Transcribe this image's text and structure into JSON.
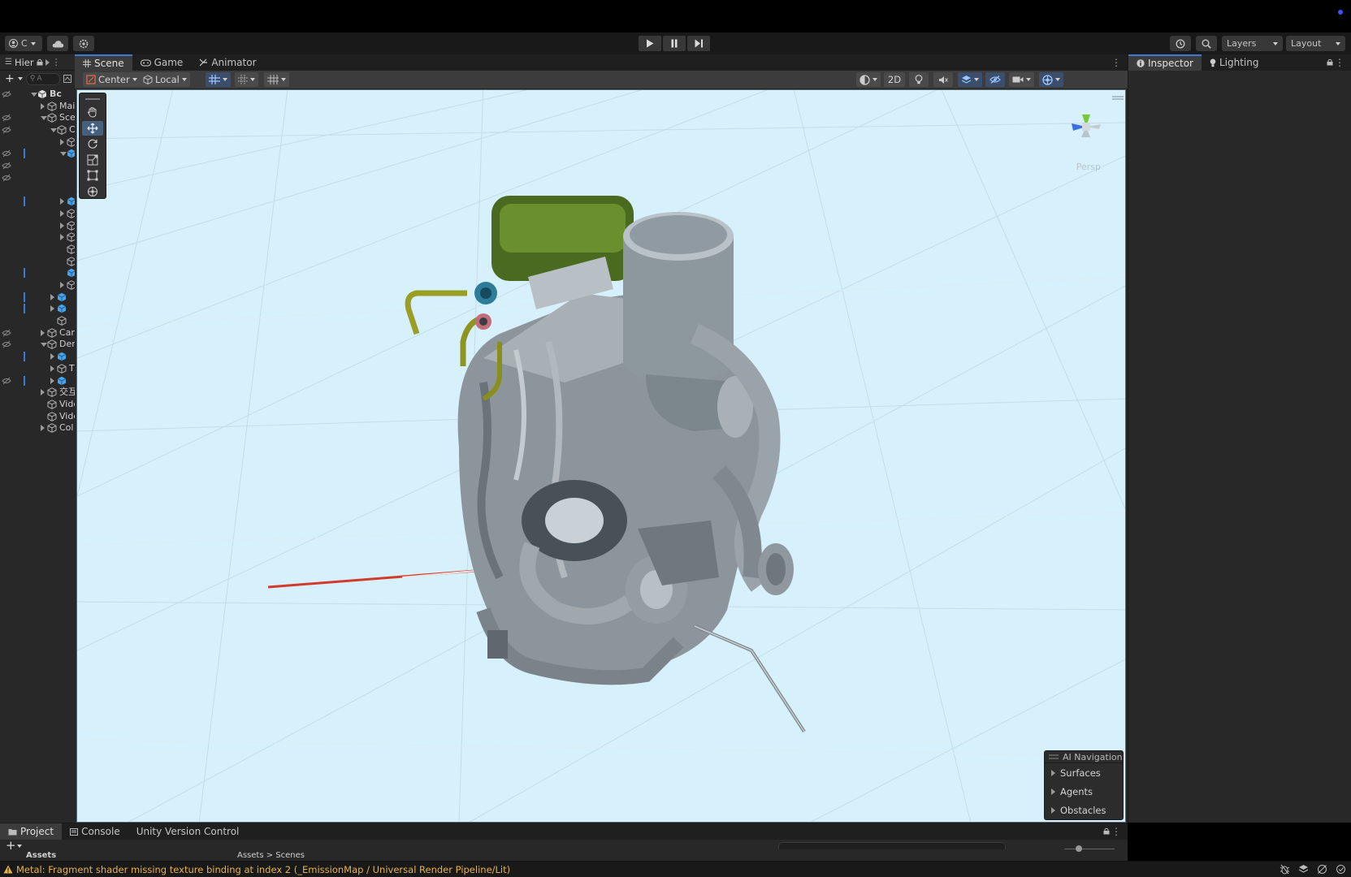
{
  "toolbar": {
    "account_label": "C",
    "layers_label": "Layers",
    "layout_label": "Layout"
  },
  "hierarchy": {
    "tab_label": "Hier",
    "search_placeholder": "A",
    "rows": [
      {
        "label": "Bc",
        "indent": 0,
        "expanded": true,
        "eye": true,
        "selected": false,
        "icon": "scene-icon",
        "bold": true
      },
      {
        "label": "Mai",
        "indent": 1,
        "expanded": false,
        "eye": false,
        "selected": false,
        "icon": "cube-outline-icon"
      },
      {
        "label": "Sce",
        "indent": 1,
        "expanded": true,
        "eye": true,
        "selected": false,
        "icon": "cube-outline-icon"
      },
      {
        "label": "C",
        "indent": 2,
        "expanded": true,
        "eye": true,
        "selected": false,
        "icon": "cube-outline-icon"
      },
      {
        "label": "",
        "indent": 3,
        "expanded": false,
        "eye": false,
        "selected": false,
        "icon": "cube-outline-icon"
      },
      {
        "label": "",
        "indent": 3,
        "expanded": true,
        "eye": true,
        "selected": true,
        "icon": "cube-blue-icon"
      },
      {
        "label": "",
        "indent": 4,
        "expanded": null,
        "eye": true,
        "selected": false,
        "icon": ""
      },
      {
        "label": "",
        "indent": 4,
        "expanded": null,
        "eye": true,
        "selected": false,
        "icon": ""
      },
      {
        "label": "",
        "indent": 4,
        "expanded": null,
        "eye": false,
        "selected": false,
        "icon": ""
      },
      {
        "label": "",
        "indent": 3,
        "expanded": false,
        "eye": false,
        "selected": true,
        "icon": "cube-blue-icon"
      },
      {
        "label": "",
        "indent": 3,
        "expanded": false,
        "eye": false,
        "selected": false,
        "icon": "cube-outline-icon"
      },
      {
        "label": "",
        "indent": 3,
        "expanded": false,
        "eye": false,
        "selected": false,
        "icon": "cube-outline-icon"
      },
      {
        "label": "",
        "indent": 3,
        "expanded": false,
        "eye": false,
        "selected": false,
        "icon": "cube-outline-icon"
      },
      {
        "label": "",
        "indent": 3,
        "expanded": null,
        "eye": false,
        "selected": false,
        "icon": "cube-outline-icon"
      },
      {
        "label": "",
        "indent": 3,
        "expanded": null,
        "eye": false,
        "selected": false,
        "icon": "cube-outline-icon"
      },
      {
        "label": "",
        "indent": 3,
        "expanded": null,
        "eye": false,
        "selected": true,
        "icon": "cube-blue-icon"
      },
      {
        "label": "",
        "indent": 3,
        "expanded": false,
        "eye": false,
        "selected": false,
        "icon": "cube-outline-icon"
      },
      {
        "label": "",
        "indent": 2,
        "expanded": false,
        "eye": false,
        "selected": true,
        "icon": "cube-blue-icon"
      },
      {
        "label": "",
        "indent": 2,
        "expanded": false,
        "eye": false,
        "selected": true,
        "icon": "cube-blue-icon"
      },
      {
        "label": "",
        "indent": 2,
        "expanded": null,
        "eye": false,
        "selected": false,
        "icon": "cube-outline-icon"
      },
      {
        "label": "Car",
        "indent": 1,
        "expanded": false,
        "eye": true,
        "selected": false,
        "icon": "cube-outline-icon"
      },
      {
        "label": "Der",
        "indent": 1,
        "expanded": true,
        "eye": true,
        "selected": false,
        "icon": "cube-outline-icon"
      },
      {
        "label": "",
        "indent": 2,
        "expanded": false,
        "eye": false,
        "selected": true,
        "icon": "cube-blue-icon"
      },
      {
        "label": "T",
        "indent": 2,
        "expanded": false,
        "eye": false,
        "selected": false,
        "icon": "cube-outline-icon"
      },
      {
        "label": "",
        "indent": 2,
        "expanded": false,
        "eye": true,
        "selected": true,
        "icon": "cube-blue-icon"
      },
      {
        "label": "交互",
        "indent": 1,
        "expanded": false,
        "eye": false,
        "selected": false,
        "icon": "cube-outline-icon"
      },
      {
        "label": "Vide",
        "indent": 1,
        "expanded": null,
        "eye": false,
        "selected": false,
        "icon": "cube-outline-icon"
      },
      {
        "label": "Vide",
        "indent": 1,
        "expanded": null,
        "eye": false,
        "selected": false,
        "icon": "cube-outline-icon"
      },
      {
        "label": "Col",
        "indent": 1,
        "expanded": false,
        "eye": false,
        "selected": false,
        "icon": "cube-outline-icon"
      }
    ]
  },
  "scene": {
    "tabs": [
      {
        "label": "Scene",
        "icon": "grid-icon",
        "active": true
      },
      {
        "label": "Game",
        "icon": "gamepad-icon",
        "active": false
      },
      {
        "label": "Animator",
        "icon": "animator-icon",
        "active": false
      }
    ],
    "pivot_label": "Center",
    "space_label": "Local",
    "mode_2d_label": "2D",
    "persp_label": "Persp",
    "ai_nav": {
      "title": "AI Navigation",
      "items": [
        "Surfaces",
        "Agents",
        "Obstacles"
      ]
    }
  },
  "inspector": {
    "tabs": [
      {
        "label": "Inspector",
        "icon": "info-icon",
        "active": true
      },
      {
        "label": "Lighting",
        "icon": "bulb-icon",
        "active": false
      }
    ]
  },
  "bottom": {
    "tabs": [
      {
        "label": "Project",
        "icon": "folder-icon",
        "active": true
      },
      {
        "label": "Console",
        "icon": "console-icon",
        "active": false
      },
      {
        "label": "Unity Version Control",
        "icon": "",
        "active": false
      }
    ],
    "assets_label": "Assets",
    "breadcrumb": "Assets > Scenes"
  },
  "status": {
    "message": "Metal: Fragment shader missing texture binding at index 2 (_EmissionMap / Universal Render Pipeline/Lit)"
  },
  "colors": {
    "accent": "#3a7bd5",
    "viewport_bg": "#d6f1fb",
    "warning": "#e6b34a"
  }
}
